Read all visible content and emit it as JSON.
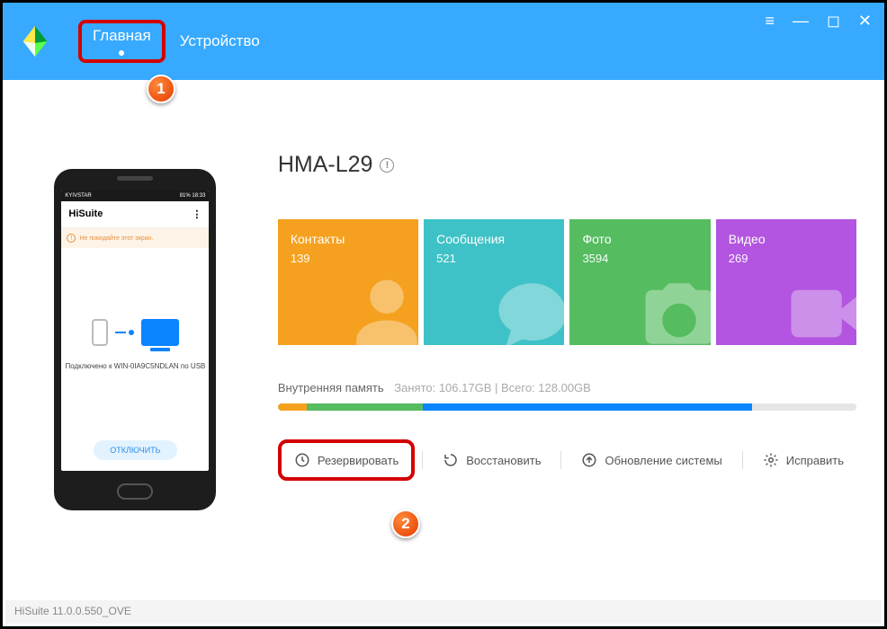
{
  "header": {
    "tabs": {
      "home": "Главная",
      "device": "Устройство"
    },
    "active_tab": "home"
  },
  "phone_mock": {
    "status_left": "KYIVSTAR",
    "status_right": "81% 18:33",
    "app_title": "HiSuite",
    "menu_glyph": "⋮",
    "warning_icon": "!",
    "warning_text": "Не покидайте этот экран.",
    "connected_text": "Подключено к WIN-0IA9C5NDLAN по USB",
    "disconnect_label": "ОТКЛЮЧИТЬ"
  },
  "device": {
    "name": "HMA-L29",
    "info_glyph": "!"
  },
  "tiles": {
    "contacts": {
      "label": "Контакты",
      "count": "139"
    },
    "messages": {
      "label": "Сообщения",
      "count": "521"
    },
    "photos": {
      "label": "Фото",
      "count": "3594"
    },
    "videos": {
      "label": "Видео",
      "count": "269"
    }
  },
  "storage": {
    "label": "Внутренняя память",
    "stat": "Занято: 106.17GB | Всего: 128.00GB"
  },
  "actions": {
    "backup": "Резервировать",
    "restore": "Восстановить",
    "update": "Обновление системы",
    "fix": "Исправить"
  },
  "footer": {
    "version": "HiSuite 11.0.0.550_OVE"
  },
  "badges": {
    "one": "1",
    "two": "2"
  },
  "win": {
    "menu": "≡",
    "min": "—",
    "max": "◻",
    "close": "✕"
  }
}
